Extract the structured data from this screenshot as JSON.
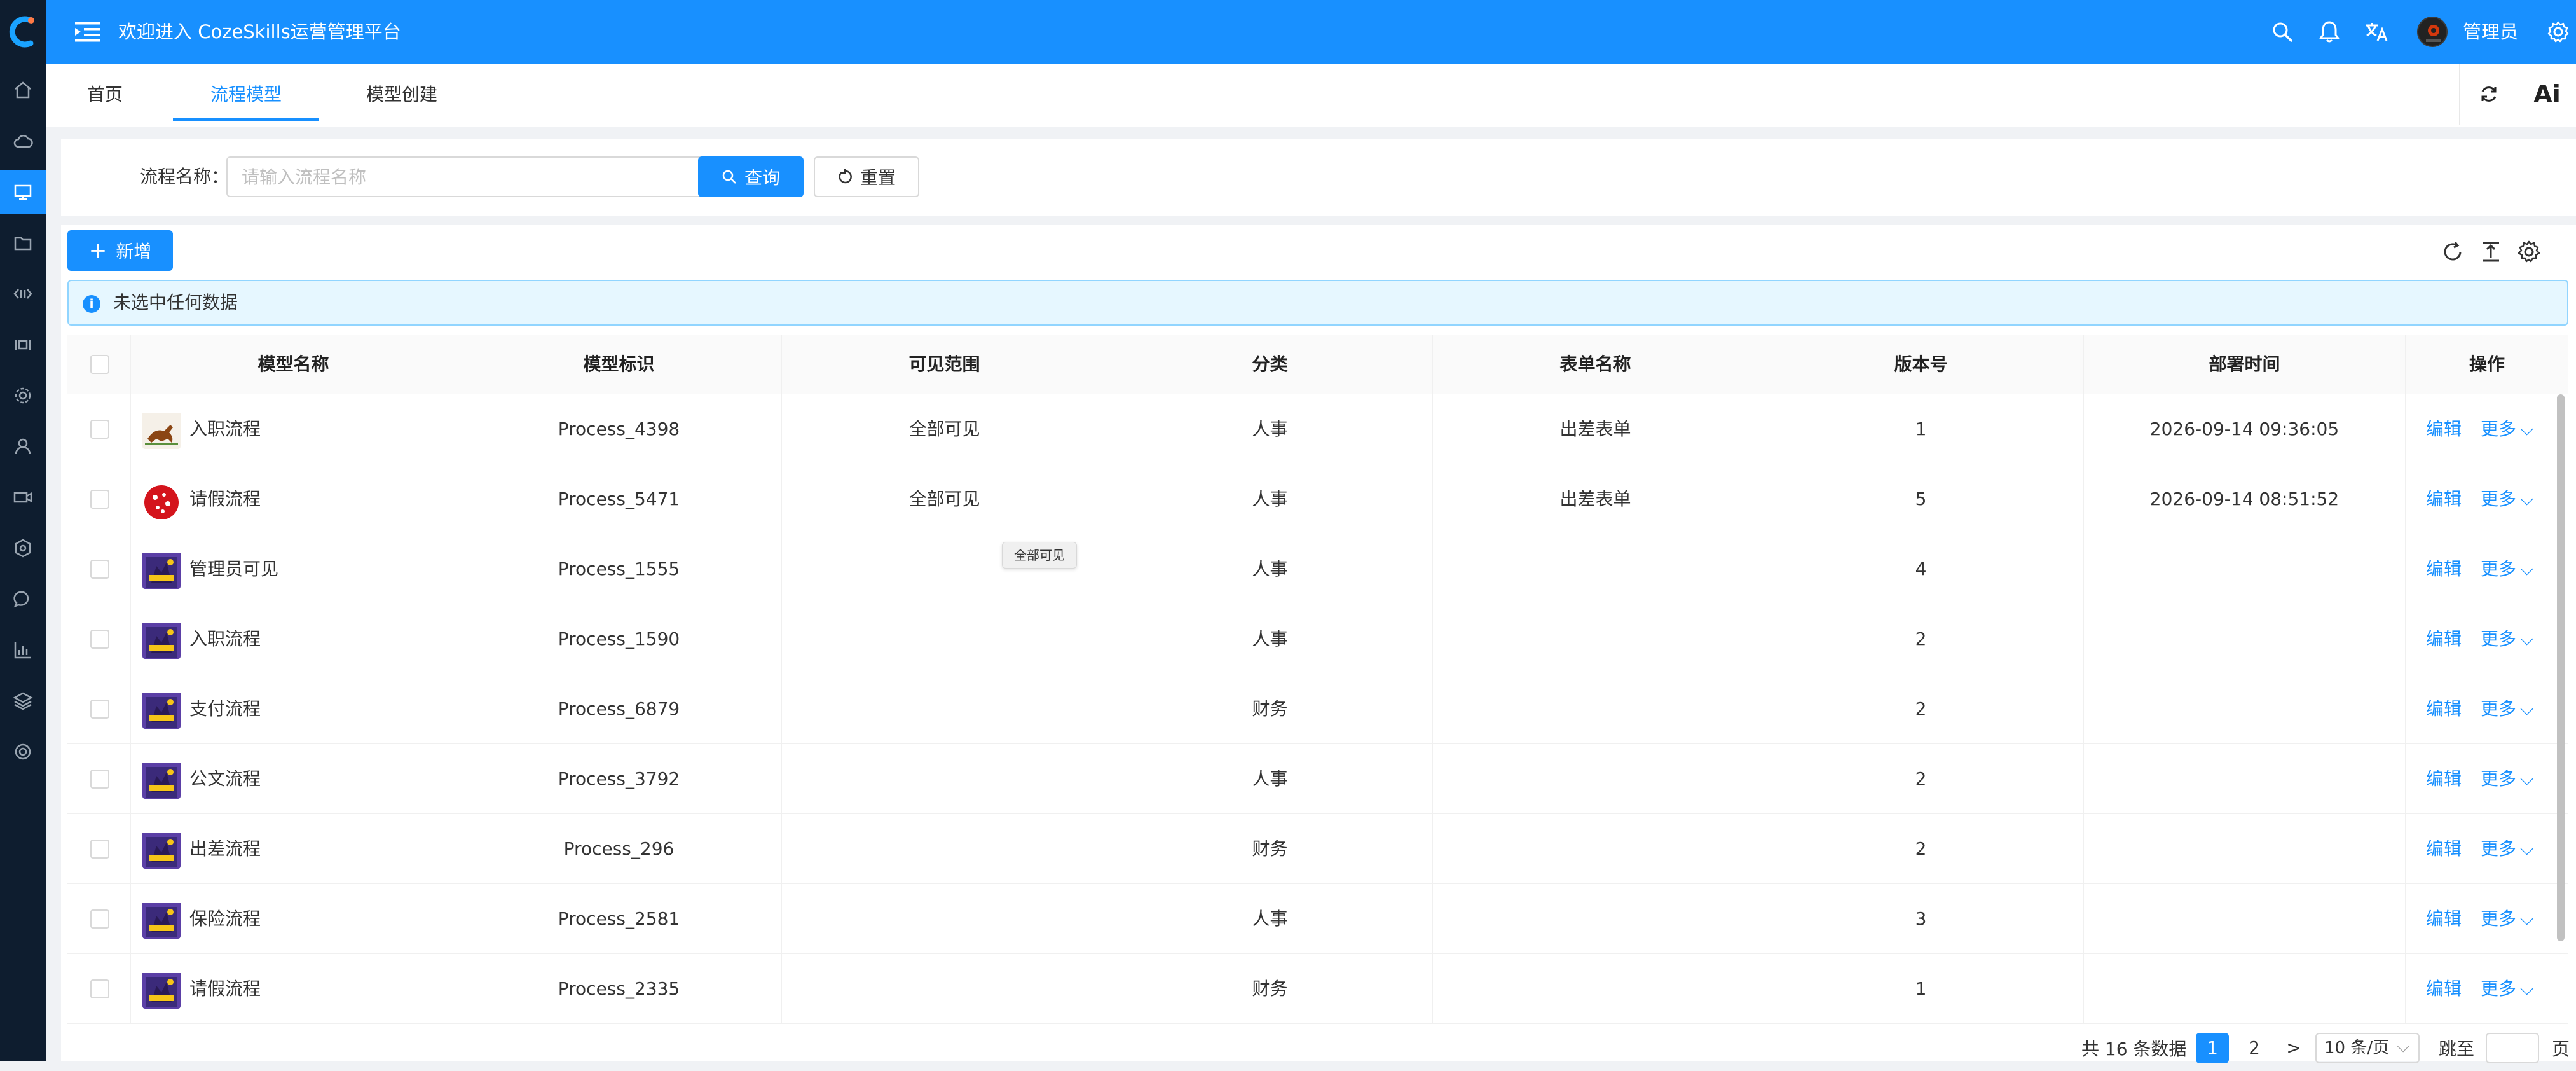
{
  "app": {
    "title": "欢迎进入 CozeSkills运营管理平台",
    "username": "管理员"
  },
  "sidebar": {
    "items": [
      {
        "icon": "home-icon"
      },
      {
        "icon": "cloud-icon"
      },
      {
        "icon": "monitor-icon",
        "active": true
      },
      {
        "icon": "folder-icon"
      },
      {
        "icon": "code-icon"
      },
      {
        "icon": "broadcast-icon"
      },
      {
        "icon": "gear-icon"
      },
      {
        "icon": "user-icon"
      },
      {
        "icon": "video-icon"
      },
      {
        "icon": "settings-gear-icon"
      },
      {
        "icon": "message-icon"
      },
      {
        "icon": "chart-icon"
      },
      {
        "icon": "layers-icon"
      },
      {
        "icon": "target-icon"
      }
    ]
  },
  "tabs": [
    {
      "label": "首页",
      "active": false
    },
    {
      "label": "流程模型",
      "active": true
    },
    {
      "label": "模型创建",
      "active": false
    }
  ],
  "tabs_right": {
    "refresh_icon": "refresh-icon",
    "more_text": "Ai"
  },
  "search": {
    "label": "流程名称：",
    "placeholder": "请输入流程名称",
    "value": "",
    "query_label": "查询",
    "reset_label": "重置"
  },
  "toolbar": {
    "add_label": "新增"
  },
  "alert": {
    "text": "未选中任何数据"
  },
  "table": {
    "columns": [
      "模型名称",
      "模型标识",
      "可见范围",
      "分类",
      "表单名称",
      "版本号",
      "部署时间",
      "操作"
    ],
    "rows": [
      {
        "name": "入职流程",
        "key": "Process_4398",
        "scope": "全部可见",
        "category": "人事",
        "form": "出差表单",
        "version": "1",
        "deployed": "2026-09-14 09:36:05",
        "thumb": "horse"
      },
      {
        "name": "请假流程",
        "key": "Process_5471",
        "scope": "全部可见",
        "category": "人事",
        "form": "出差表单",
        "version": "5",
        "deployed": "2026-09-14 08:51:52",
        "thumb": "red"
      },
      {
        "name": "管理员可见",
        "key": "Process_1555",
        "scope": "",
        "category": "人事",
        "form": "",
        "version": "4",
        "deployed": "",
        "thumb": "purple"
      },
      {
        "name": "入职流程",
        "key": "Process_1590",
        "scope": "",
        "category": "人事",
        "form": "",
        "version": "2",
        "deployed": "",
        "thumb": "purple"
      },
      {
        "name": "支付流程",
        "key": "Process_6879",
        "scope": "",
        "category": "财务",
        "form": "",
        "version": "2",
        "deployed": "",
        "thumb": "purple"
      },
      {
        "name": "公文流程",
        "key": "Process_3792",
        "scope": "",
        "category": "人事",
        "form": "",
        "version": "2",
        "deployed": "",
        "thumb": "purple"
      },
      {
        "name": "出差流程",
        "key": "Process_296",
        "scope": "",
        "category": "财务",
        "form": "",
        "version": "2",
        "deployed": "",
        "thumb": "purple"
      },
      {
        "name": "保险流程",
        "key": "Process_2581",
        "scope": "",
        "category": "人事",
        "form": "",
        "version": "3",
        "deployed": "",
        "thumb": "purple"
      },
      {
        "name": "请假流程",
        "key": "Process_2335",
        "scope": "",
        "category": "财务",
        "form": "",
        "version": "1",
        "deployed": "",
        "thumb": "purple"
      }
    ],
    "actions": {
      "edit": "编辑",
      "more": "更多"
    }
  },
  "tooltip": {
    "text": "全部可见"
  },
  "pagination": {
    "total_text": "共 16 条数据",
    "pages": [
      "1",
      "2"
    ],
    "current": "1",
    "next": ">",
    "page_size": "10 条/页",
    "jump_label": "跳至",
    "page_suffix": "页"
  },
  "colors": {
    "primary": "#1890ff",
    "sidebar_bg": "#0e1d2f",
    "alert_bg": "#e6f7ff"
  }
}
